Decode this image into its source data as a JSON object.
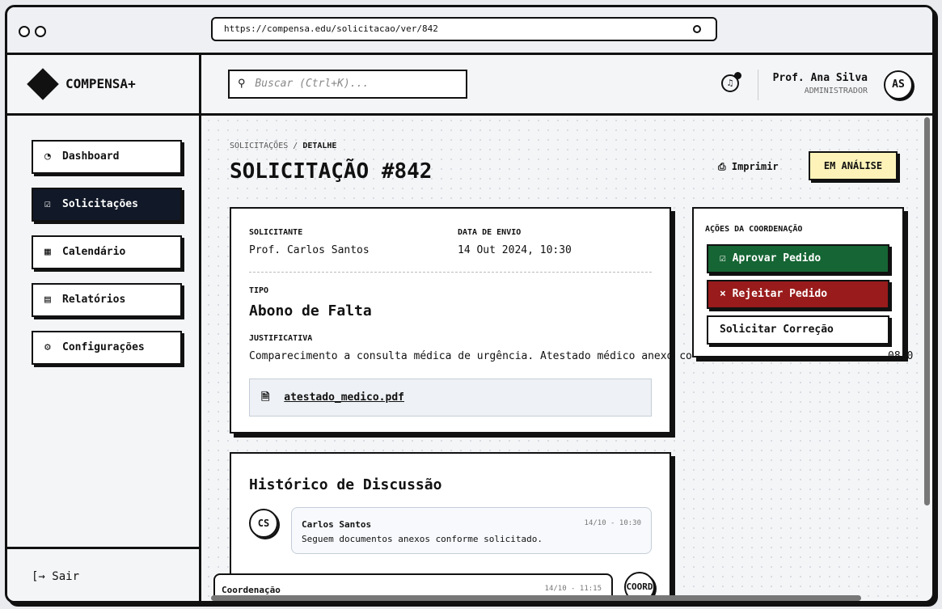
{
  "browser": {
    "url": "https://compensa.edu/solicitacao/ver/842"
  },
  "brand": {
    "name": "COMPENSA+"
  },
  "topbar": {
    "search_placeholder": "Buscar (Ctrl+K)...",
    "user_name": "Prof. Ana Silva",
    "user_role": "ADMINISTRADOR",
    "user_initials": "AS"
  },
  "sidebar": {
    "items": [
      {
        "label": "Dashboard",
        "icon": "pie-chart-icon",
        "active": false
      },
      {
        "label": "Solicitações",
        "icon": "check-square-icon",
        "active": true
      },
      {
        "label": "Calendário",
        "icon": "calendar-icon",
        "active": false
      },
      {
        "label": "Relatórios",
        "icon": "document-icon",
        "active": false
      },
      {
        "label": "Configurações",
        "icon": "gear-icon",
        "active": false
      }
    ],
    "logout": "Sair"
  },
  "page": {
    "breadcrumb_parent": "SOLICITAÇÕES",
    "breadcrumb_sep": " / ",
    "breadcrumb_current": "DETALHE",
    "title": "SOLICITAÇÃO #842",
    "print_label": "Imprimir",
    "status": "EM ANÁLISE"
  },
  "details": {
    "requester_label": "SOLICITANTE",
    "requester": "Prof. Carlos Santos",
    "date_label": "DATA DE ENVIO",
    "date": "14 Out 2024, 10:30",
    "type_label": "TIPO",
    "type": "Abono de Falta",
    "justification_label": "JUSTIFICATIVA",
    "justification": "Comparecimento a consulta médica de urgência. Atestado médico anexo co",
    "justification_overflow": "08:0",
    "attachment": "atestado_medico.pdf"
  },
  "actions": {
    "title": "AÇÕES DA COORDENAÇÃO",
    "approve": "Aprovar Pedido",
    "reject": "Rejeitar Pedido",
    "correction": "Solicitar Correção"
  },
  "history": {
    "title": "Histórico de Discussão",
    "messages": [
      {
        "initials": "CS",
        "author": "Carlos Santos",
        "time": "14/10 - 10:30",
        "text": "Seguem documentos anexos conforme solicitado."
      },
      {
        "initials": "COORD",
        "author": "Coordenação",
        "time": "14/10 - 11:15",
        "text": ""
      }
    ]
  },
  "colors": {
    "approve": "#166534",
    "reject": "#991b1b",
    "status_bg": "#fdf3b8",
    "active_nav": "#111827"
  }
}
